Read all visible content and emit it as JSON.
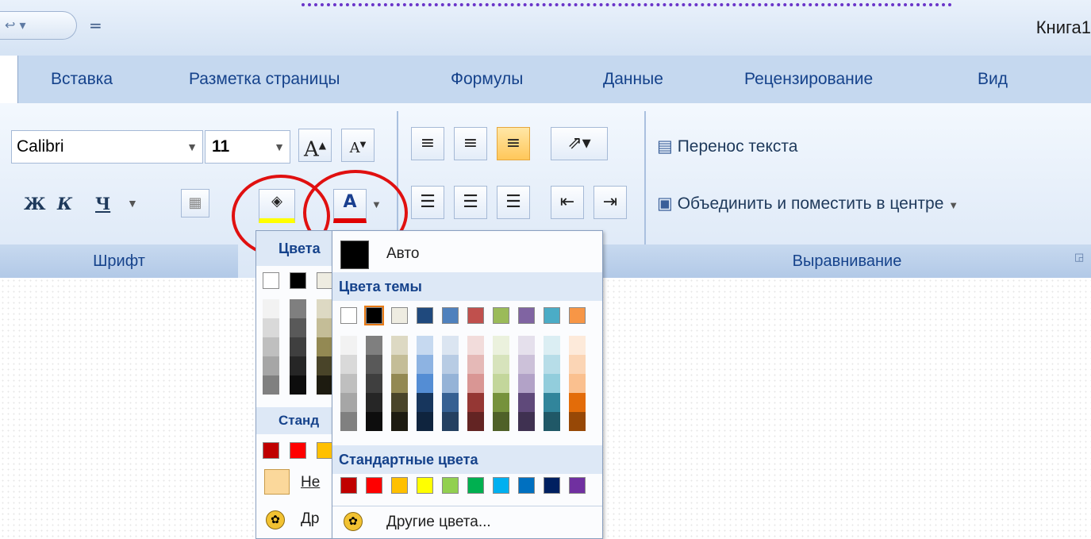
{
  "window": {
    "title": "Книга1",
    "qa_undo": "↩ ▾",
    "qa_more": "="
  },
  "tabs": [
    "Вставка",
    "Разметка страницы",
    "Формулы",
    "Данные",
    "Рецензирование",
    "Вид"
  ],
  "font_group": {
    "font_name": "Calibri",
    "font_size": "11",
    "grow_label": "A",
    "shrink_label": "A",
    "bold": "Ж",
    "italic": "К",
    "underline": "Ч",
    "footer": "Шрифт"
  },
  "align_group": {
    "wrap_text": "Перенос текста",
    "merge_center": "Объединить и поместить в центре",
    "footer": "Выравнивание"
  },
  "fill_dropdown": {
    "header": "Цвета",
    "standard_header": "Станд",
    "no_fill": "Не",
    "more": "Др"
  },
  "font_color_dropdown": {
    "auto": "Авто",
    "theme_header": "Цвета темы",
    "standard_header": "Стандартные цвета",
    "more": "Другие цвета..."
  },
  "theme_colors": [
    [
      "#FFFFFF",
      "#F2F2F2",
      "#D9D9D9",
      "#BFBFBF",
      "#A6A6A6",
      "#808080"
    ],
    [
      "#000000",
      "#7F7F7F",
      "#595959",
      "#3F3F3F",
      "#262626",
      "#0D0D0D"
    ],
    [
      "#EEECE1",
      "#DDD9C3",
      "#C4BD97",
      "#938953",
      "#494429",
      "#1D1B10"
    ],
    [
      "#1F497D",
      "#C6D9F0",
      "#8DB3E2",
      "#548DD4",
      "#17365D",
      "#0F243E"
    ],
    [
      "#4F81BD",
      "#DBE5F1",
      "#B8CCE4",
      "#95B3D7",
      "#366092",
      "#244061"
    ],
    [
      "#C0504D",
      "#F2DCDB",
      "#E5B9B7",
      "#D99694",
      "#953734",
      "#632423"
    ],
    [
      "#9BBB59",
      "#EBF1DD",
      "#D7E3BC",
      "#C3D69B",
      "#76923C",
      "#4F6128"
    ],
    [
      "#8064A2",
      "#E5E0EC",
      "#CCC1D9",
      "#B2A2C7",
      "#5F497A",
      "#3F3151"
    ],
    [
      "#4BACC6",
      "#DBEEF3",
      "#B7DDE8",
      "#92CDDC",
      "#31859B",
      "#205867"
    ],
    [
      "#F79646",
      "#FDEADA",
      "#FBD5B5",
      "#FAC08F",
      "#E36C09",
      "#974806"
    ]
  ],
  "standard_colors": [
    "#C00000",
    "#FF0000",
    "#FFC000",
    "#FFFF00",
    "#92D050",
    "#00B050",
    "#00B0F0",
    "#0070C0",
    "#002060",
    "#7030A0"
  ],
  "accent": {
    "ribbon_text": "#15428B",
    "highlight_circle": "#E01010"
  }
}
